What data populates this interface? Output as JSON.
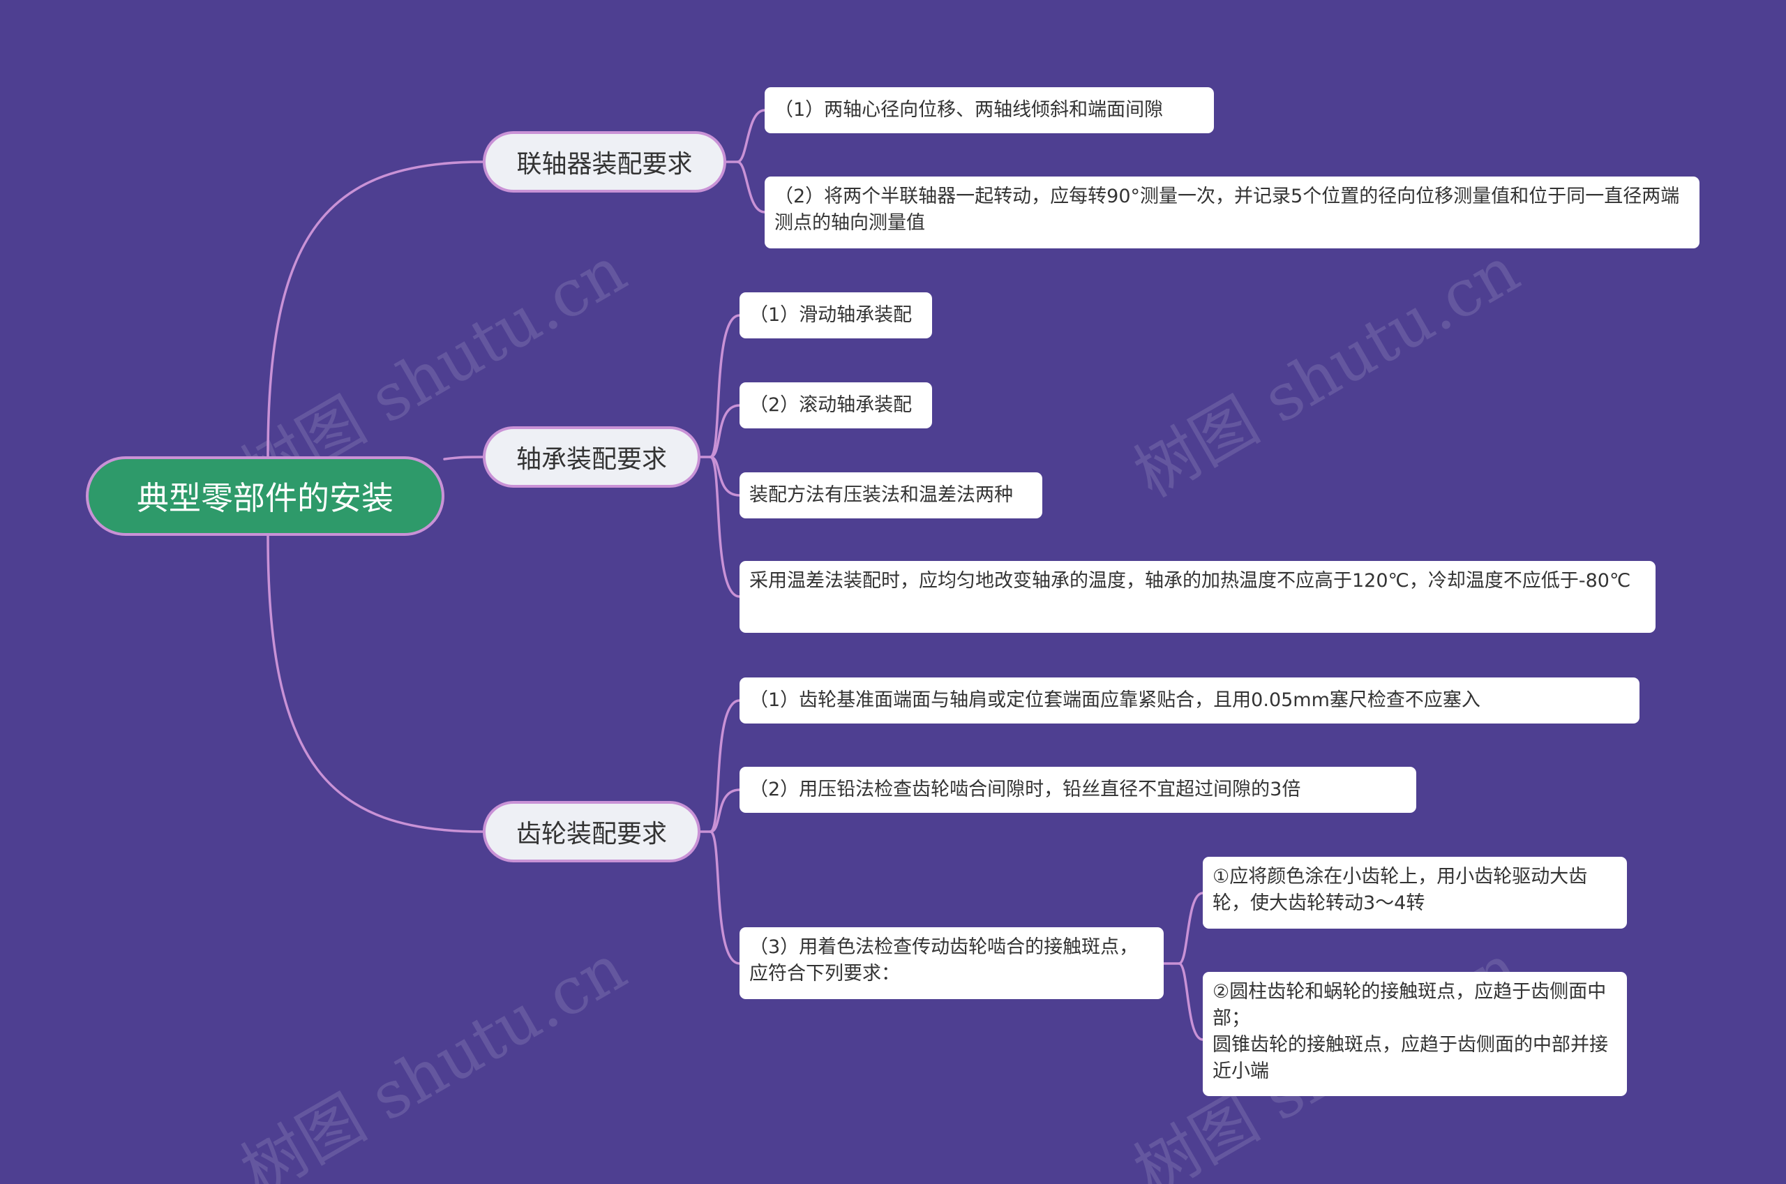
{
  "root": {
    "label": "典型零部件的安装"
  },
  "branches": [
    {
      "label": "联轴器装配要求",
      "children": [
        {
          "text": "（1）两轴心径向位移、两轴线倾斜和端面间隙"
        },
        {
          "text": "（2）将两个半联轴器一起转动，应每转90°测量一次，并记录5个位置的径向位移测量值和位于同一直径两端测点的轴向测量值"
        }
      ]
    },
    {
      "label": "轴承装配要求",
      "children": [
        {
          "text": "（1）滑动轴承装配"
        },
        {
          "text": "（2）滚动轴承装配"
        },
        {
          "text": "装配方法有压装法和温差法两种"
        },
        {
          "text": "采用温差法装配时，应均匀地改变轴承的温度，轴承的加热温度不应高于120℃，冷却温度不应低于-80℃"
        }
      ]
    },
    {
      "label": "齿轮装配要求",
      "children": [
        {
          "text": "（1）齿轮基准面端面与轴肩或定位套端面应靠紧贴合，且用0.05mm塞尺检查不应塞入"
        },
        {
          "text": "（2）用压铅法检查齿轮啮合间隙时，铅丝直径不宜超过间隙的3倍"
        },
        {
          "text": "（3）用着色法检查传动齿轮啮合的接触斑点，应符合下列要求：",
          "children": [
            {
              "text": "①应将颜色涂在小齿轮上，用小齿轮驱动大齿轮，使大齿轮转动3～4转"
            },
            {
              "text": "②圆柱齿轮和蜗轮的接触斑点，应趋于齿侧面中部；\n圆锥齿轮的接触斑点，应趋于齿侧面的中部并接近小端"
            }
          ]
        }
      ]
    }
  ],
  "watermark": "树图 shutu.cn",
  "colors": {
    "background": "#4e3f91",
    "root_fill": "#2e9a6a",
    "connector": "#c992d6",
    "branch_fill": "#eef0f5",
    "leaf_fill": "#ffffff"
  }
}
